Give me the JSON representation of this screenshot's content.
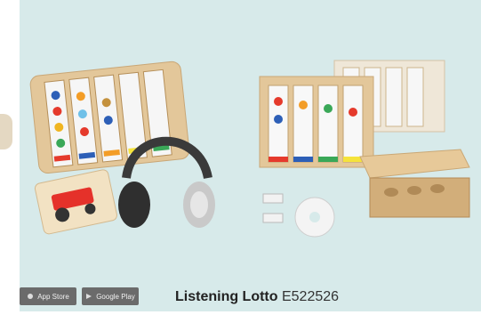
{
  "product": {
    "name": "Listening Lotto",
    "code": "E522526"
  },
  "badges": [
    {
      "label": "App Store",
      "icon": "apple-icon"
    },
    {
      "label": "Google Play",
      "icon": "google-play-icon"
    }
  ],
  "colors": {
    "panel": "#d7eaea",
    "wood": "#e3c79a",
    "badge": "#6b6b6b"
  }
}
